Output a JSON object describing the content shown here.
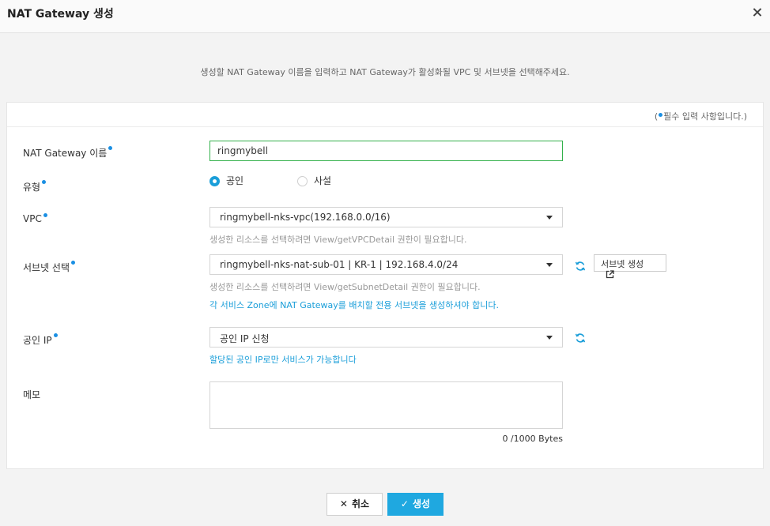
{
  "dialog": {
    "title": "NAT Gateway 생성",
    "description": "생성할 NAT Gateway 이름을 입력하고 NAT Gateway가 활성화될 VPC 및 서브넷을 선택해주세요."
  },
  "form": {
    "required_note_prefix": "(",
    "required_note_text": "필수 입력 사항입니다.)",
    "name": {
      "label": "NAT Gateway 이름",
      "value": "ringmybell"
    },
    "type": {
      "label": "유형",
      "options": [
        "공인",
        "사설"
      ],
      "selected": "공인"
    },
    "vpc": {
      "label": "VPC",
      "value": "ringmybell-nks-vpc(192.168.0.0/16)",
      "hint": "생성한 리소스를 선택하려면 View/getVPCDetail 권한이 필요합니다."
    },
    "subnet": {
      "label": "서브넷 선택",
      "value": "ringmybell-nks-nat-sub-01 | KR-1 | 192.168.4.0/24",
      "hint": "생성한 리소스를 선택하려면 View/getSubnetDetail 권한이 필요합니다.",
      "notice": "각 서비스 Zone에 NAT Gateway를 배치할 전용 서브넷을 생성하셔야 합니다.",
      "create_button": "서브넷 생성"
    },
    "public_ip": {
      "label": "공인 IP",
      "value": "공인 IP 신청",
      "notice": "할당된 공인 IP로만 서비스가 가능합니다"
    },
    "memo": {
      "label": "메모",
      "counter": "0 /1000 Bytes"
    }
  },
  "footer": {
    "cancel": "취소",
    "create": "생성"
  },
  "colors": {
    "accent": "#1fa8e0",
    "required_dot": "#1a8fe3",
    "focus_border": "#33b14b"
  }
}
